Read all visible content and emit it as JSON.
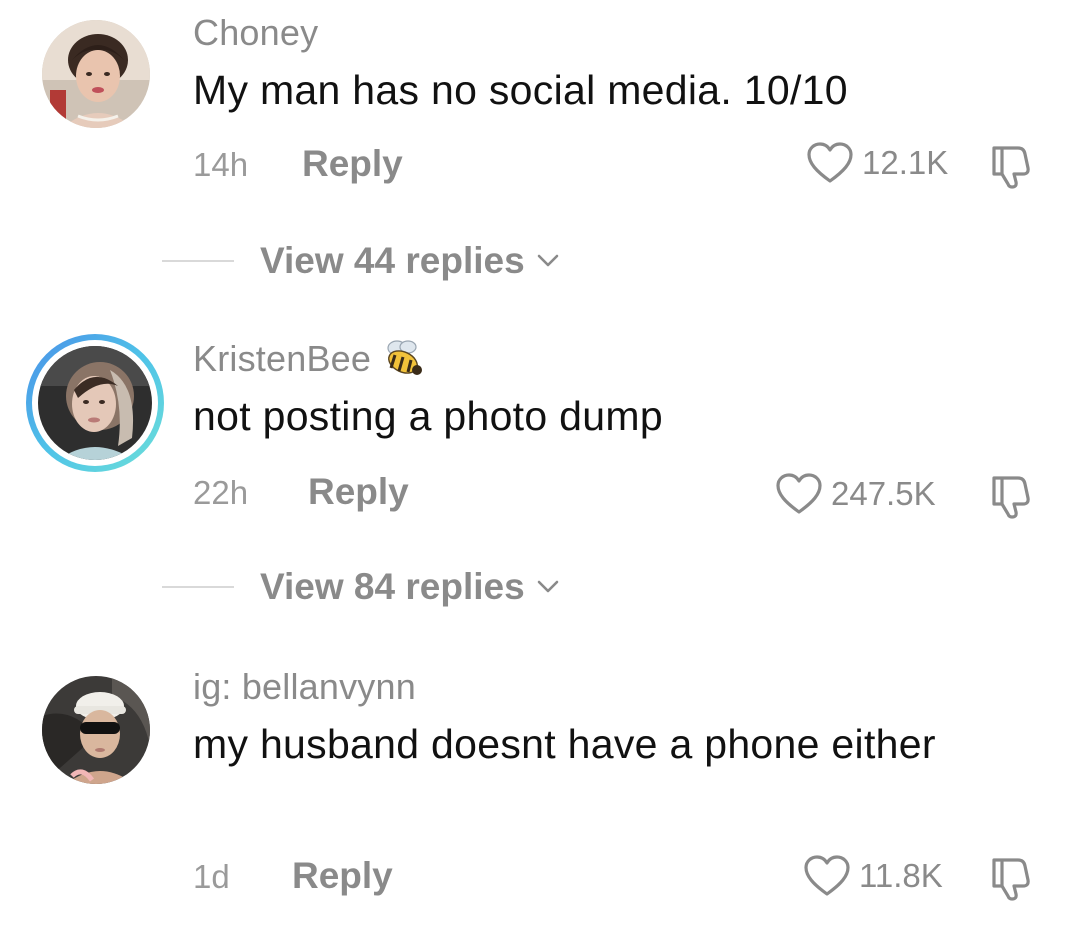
{
  "comments": [
    {
      "username": "Choney",
      "text": "My man has no social media. 10/10",
      "time": "14h",
      "reply_label": "Reply",
      "likes": "12.1K",
      "replies_label": "View 44 replies"
    },
    {
      "username": "KristenBee",
      "text": "not posting a photo dump",
      "time": "22h",
      "reply_label": "Reply",
      "likes": "247.5K",
      "replies_label": "View 84 replies",
      "has_story_ring": true,
      "badge_icon": "bee-icon"
    },
    {
      "username": "ig: bellanvynn",
      "text": "my husband doesnt have a phone either",
      "time": "1d",
      "reply_label": "Reply",
      "likes": "11.8K"
    }
  ],
  "icons": {
    "like": "heart-outline-icon",
    "dislike": "thumbs-down-outline-icon",
    "expand": "chevron-down-icon"
  },
  "colors": {
    "secondary_text": "#8a8a8a",
    "primary_text": "#111111",
    "story_ring_start": "#4a8fe8",
    "story_ring_end": "#6ee0d8"
  }
}
